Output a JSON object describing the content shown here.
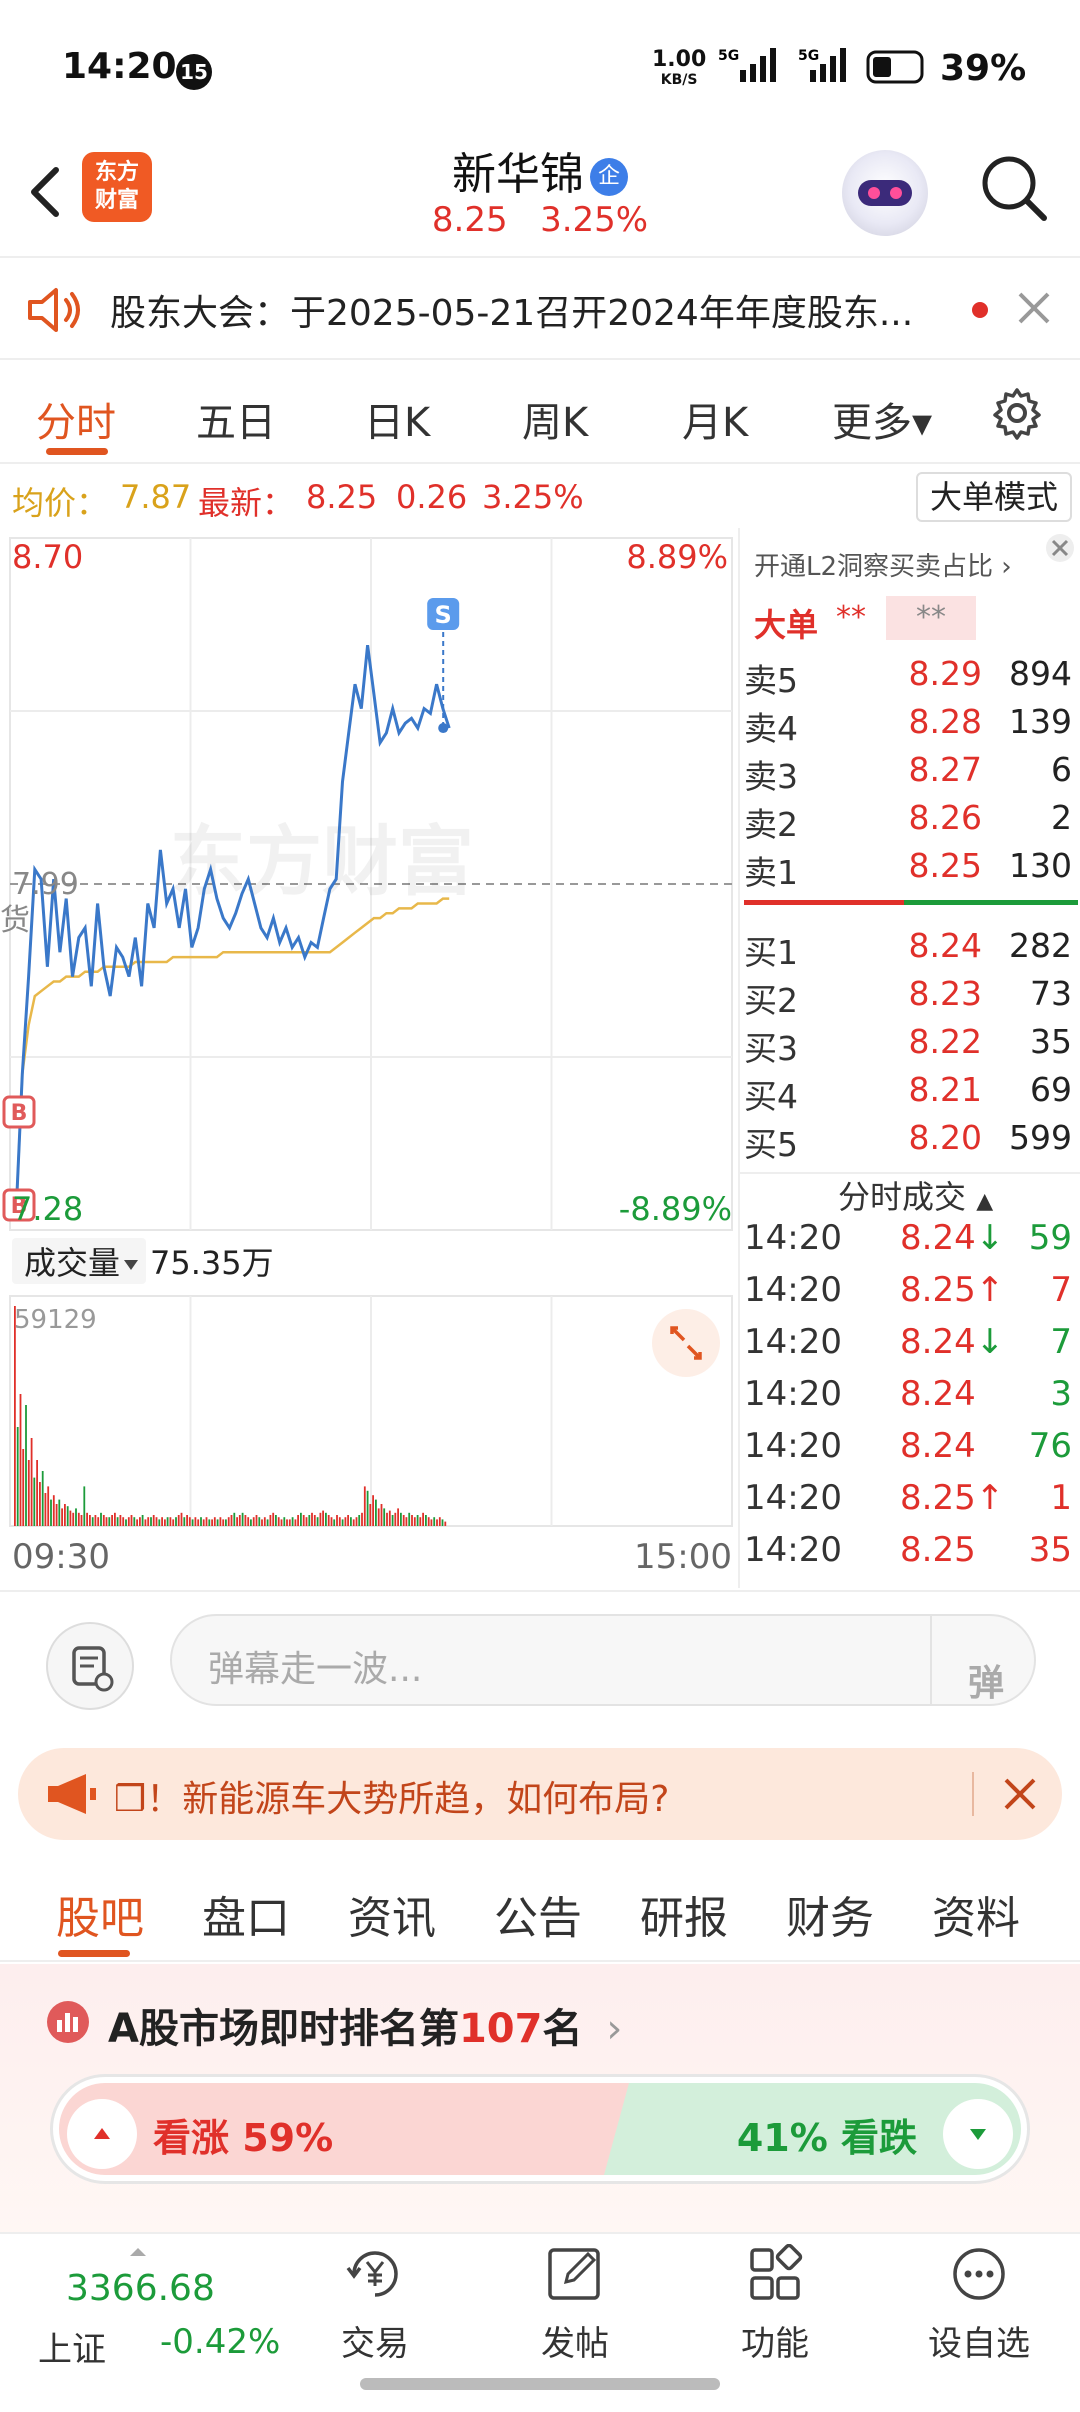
{
  "status_bar": {
    "time": "14:20",
    "notification_count": "15",
    "net_speed": "1.00",
    "net_speed_unit": "KB/S",
    "signal1": "5G",
    "signal2": "5G",
    "battery": "39%"
  },
  "header": {
    "logo_text_line1": "东方",
    "logo_text_line2": "财富",
    "stock_name": "新华锦",
    "badge": "企",
    "price": "8.25",
    "change_pct": "3.25%"
  },
  "notice": {
    "text": "股东大会：于2025-05-21召开2024年年度股东..."
  },
  "chart_tabs": [
    "分时",
    "五日",
    "日K",
    "周K",
    "月K",
    "更多▾"
  ],
  "info_row": {
    "avg_label": "均价：",
    "avg_value": "7.87",
    "latest_label": "最新：",
    "latest_value": "8.25",
    "change": "0.26",
    "change_pct": "3.25%",
    "mode_button": "大单模式"
  },
  "chart_data": {
    "type": "line",
    "title": "",
    "y_max_label": "8.70",
    "y_min_label": "7.28",
    "pct_max_label": "8.89%",
    "pct_min_label": "-8.89%",
    "prev_close_label": "7.99",
    "x_start_label": "09:30",
    "x_end_label": "15:00",
    "ylim": [
      7.28,
      8.7
    ],
    "prev_close": 7.99,
    "marker_b": "B",
    "marker_s": "S",
    "watermark": "东方财富",
    "cut_label": "货",
    "series": [
      {
        "values": [
          7.31,
          7.6,
          7.8,
          8.02,
          8.0,
          7.82,
          8.0,
          7.85,
          7.96,
          7.8,
          7.88,
          7.9,
          7.78,
          7.95,
          7.82,
          7.76,
          7.86,
          7.84,
          7.8,
          7.88,
          7.78,
          7.95,
          7.9,
          8.06,
          7.95,
          7.98,
          7.9,
          7.98,
          7.86,
          7.9,
          7.98,
          8.02,
          7.96,
          7.92,
          7.9,
          7.93,
          7.97,
          8.0,
          7.95,
          7.9,
          7.88,
          7.92,
          7.87,
          7.9,
          7.86,
          7.88,
          7.84,
          7.87,
          7.86,
          7.92,
          7.98,
          8.0,
          8.2,
          8.3,
          8.4,
          8.35,
          8.48,
          8.38,
          8.28,
          8.3,
          8.35,
          8.3,
          8.32,
          8.33,
          8.31,
          8.35,
          8.34,
          8.4,
          8.35,
          8.31
        ]
      },
      {
        "values": [
          7.31,
          7.6,
          7.7,
          7.76,
          7.77,
          7.78,
          7.79,
          7.79,
          7.8,
          7.8,
          7.8,
          7.81,
          7.81,
          7.81,
          7.82,
          7.82,
          7.82,
          7.82,
          7.82,
          7.83,
          7.83,
          7.83,
          7.83,
          7.83,
          7.83,
          7.84,
          7.84,
          7.84,
          7.84,
          7.84,
          7.84,
          7.84,
          7.84,
          7.85,
          7.85,
          7.85,
          7.85,
          7.85,
          7.85,
          7.85,
          7.85,
          7.85,
          7.85,
          7.85,
          7.85,
          7.85,
          7.85,
          7.85,
          7.85,
          7.85,
          7.85,
          7.86,
          7.87,
          7.88,
          7.89,
          7.9,
          7.91,
          7.92,
          7.92,
          7.93,
          7.93,
          7.94,
          7.94,
          7.94,
          7.95,
          7.95,
          7.95,
          7.95,
          7.96,
          7.96
        ]
      }
    ],
    "volume": {
      "label": "成交量",
      "total": "75.35万",
      "max_label": "59129",
      "bars": [
        1.0,
        0.45,
        0.6,
        0.35,
        0.55,
        0.3,
        0.4,
        0.22,
        0.3,
        0.2,
        0.25,
        0.15,
        0.18,
        0.12,
        0.14,
        0.1,
        0.12,
        0.08,
        0.1,
        0.09,
        0.07,
        0.06,
        0.08,
        0.06,
        0.05,
        0.18,
        0.06,
        0.05,
        0.04,
        0.05,
        0.04,
        0.06,
        0.05,
        0.04,
        0.04,
        0.05,
        0.06,
        0.04,
        0.05,
        0.04,
        0.03,
        0.04,
        0.05,
        0.04,
        0.03,
        0.04,
        0.05,
        0.03,
        0.04,
        0.04,
        0.05,
        0.04,
        0.03,
        0.04,
        0.03,
        0.04,
        0.04,
        0.03,
        0.04,
        0.05,
        0.06,
        0.04,
        0.05,
        0.04,
        0.03,
        0.04,
        0.03,
        0.04,
        0.03,
        0.04,
        0.03,
        0.03,
        0.04,
        0.03,
        0.04,
        0.03,
        0.03,
        0.04,
        0.05,
        0.06,
        0.04,
        0.05,
        0.06,
        0.05,
        0.04,
        0.03,
        0.04,
        0.05,
        0.04,
        0.03,
        0.04,
        0.03,
        0.05,
        0.06,
        0.05,
        0.04,
        0.03,
        0.04,
        0.03,
        0.03,
        0.04,
        0.03,
        0.05,
        0.06,
        0.05,
        0.04,
        0.05,
        0.06,
        0.05,
        0.04,
        0.06,
        0.07,
        0.06,
        0.05,
        0.04,
        0.03,
        0.05,
        0.04,
        0.03,
        0.04,
        0.05,
        0.04,
        0.03,
        0.04,
        0.05,
        0.06,
        0.18,
        0.16,
        0.1,
        0.14,
        0.12,
        0.08,
        0.1,
        0.08,
        0.06,
        0.07,
        0.05,
        0.06,
        0.08,
        0.06,
        0.05,
        0.04,
        0.06,
        0.05,
        0.04,
        0.05,
        0.04,
        0.06,
        0.05,
        0.04,
        0.03,
        0.04,
        0.03,
        0.04,
        0.03,
        0.02
      ]
    }
  },
  "orderbook": {
    "promo": "开通L2洞察买卖占比 ›",
    "big_order_label": "大单",
    "big_order_value": "**",
    "big_order_value2": "**",
    "asks": [
      {
        "label": "卖5",
        "price": "8.29",
        "vol": "894"
      },
      {
        "label": "卖4",
        "price": "8.28",
        "vol": "139"
      },
      {
        "label": "卖3",
        "price": "8.27",
        "vol": "6"
      },
      {
        "label": "卖2",
        "price": "8.26",
        "vol": "2"
      },
      {
        "label": "卖1",
        "price": "8.25",
        "vol": "130"
      }
    ],
    "bids": [
      {
        "label": "买1",
        "price": "8.24",
        "vol": "282"
      },
      {
        "label": "买2",
        "price": "8.23",
        "vol": "73"
      },
      {
        "label": "买3",
        "price": "8.22",
        "vol": "35"
      },
      {
        "label": "买4",
        "price": "8.21",
        "vol": "69"
      },
      {
        "label": "买5",
        "price": "8.20",
        "vol": "599"
      }
    ],
    "ticks_title": "分时成交",
    "ticks": [
      {
        "time": "14:20",
        "price": "8.24↓",
        "vol": "59",
        "dir": "down"
      },
      {
        "time": "14:20",
        "price": "8.25↑",
        "vol": "7",
        "dir": "up"
      },
      {
        "time": "14:20",
        "price": "8.24↓",
        "vol": "7",
        "dir": "down"
      },
      {
        "time": "14:20",
        "price": "8.24",
        "vol": "3",
        "dir": "down"
      },
      {
        "time": "14:20",
        "price": "8.24",
        "vol": "76",
        "dir": "down"
      },
      {
        "time": "14:20",
        "price": "8.25↑",
        "vol": "1",
        "dir": "up"
      },
      {
        "time": "14:20",
        "price": "8.25",
        "vol": "35",
        "dir": "up"
      }
    ]
  },
  "danmu": {
    "placeholder": "弹幕走一波...",
    "send": "弹"
  },
  "promo": {
    "text": "❒！新能源车大势所趋，如何布局?"
  },
  "bottom_tabs": [
    "股吧",
    "盘口",
    "资讯",
    "公告",
    "研报",
    "财务",
    "资料"
  ],
  "rank": {
    "prefix": "A股市场即时排名第",
    "number": "107",
    "suffix": "名"
  },
  "vote": {
    "up_label": "看涨 59%",
    "down_label": "41% 看跌",
    "up_fraction": 0.59
  },
  "bottom_nav": {
    "index_value": "3366.68",
    "index_name": "上证",
    "index_change": "-0.42%",
    "items": [
      "交易",
      "发帖",
      "功能",
      "设自选"
    ]
  },
  "colors": {
    "up": "#e0302a",
    "down": "#1c9b3a",
    "accent": "#e05520",
    "price_line": "#3a78c9",
    "avg_line": "#e8b84a"
  }
}
